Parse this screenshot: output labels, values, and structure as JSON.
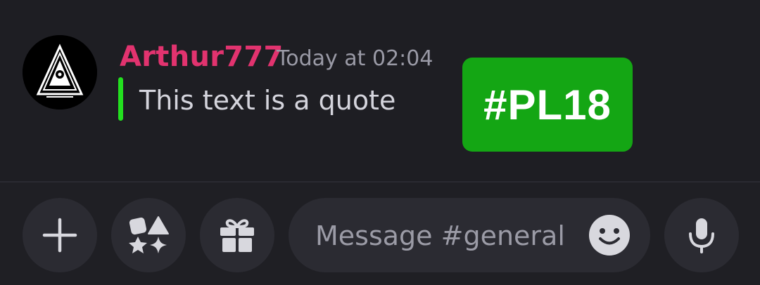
{
  "message": {
    "author": "Arthur777",
    "timestamp": "Today at 02:04",
    "quote": "This text is a quote",
    "tag": "#PL18",
    "author_color": "#e2336f",
    "quote_bar_color": "#23e01f",
    "tag_bg_color": "#14a614"
  },
  "composer": {
    "placeholder": "Message #general",
    "buttons": [
      {
        "name": "add",
        "icon": "plus-icon"
      },
      {
        "name": "apps",
        "icon": "apps-icon"
      },
      {
        "name": "gift",
        "icon": "gift-icon"
      },
      {
        "name": "emoji",
        "icon": "emoji-icon"
      },
      {
        "name": "voice",
        "icon": "microphone-icon"
      }
    ]
  }
}
